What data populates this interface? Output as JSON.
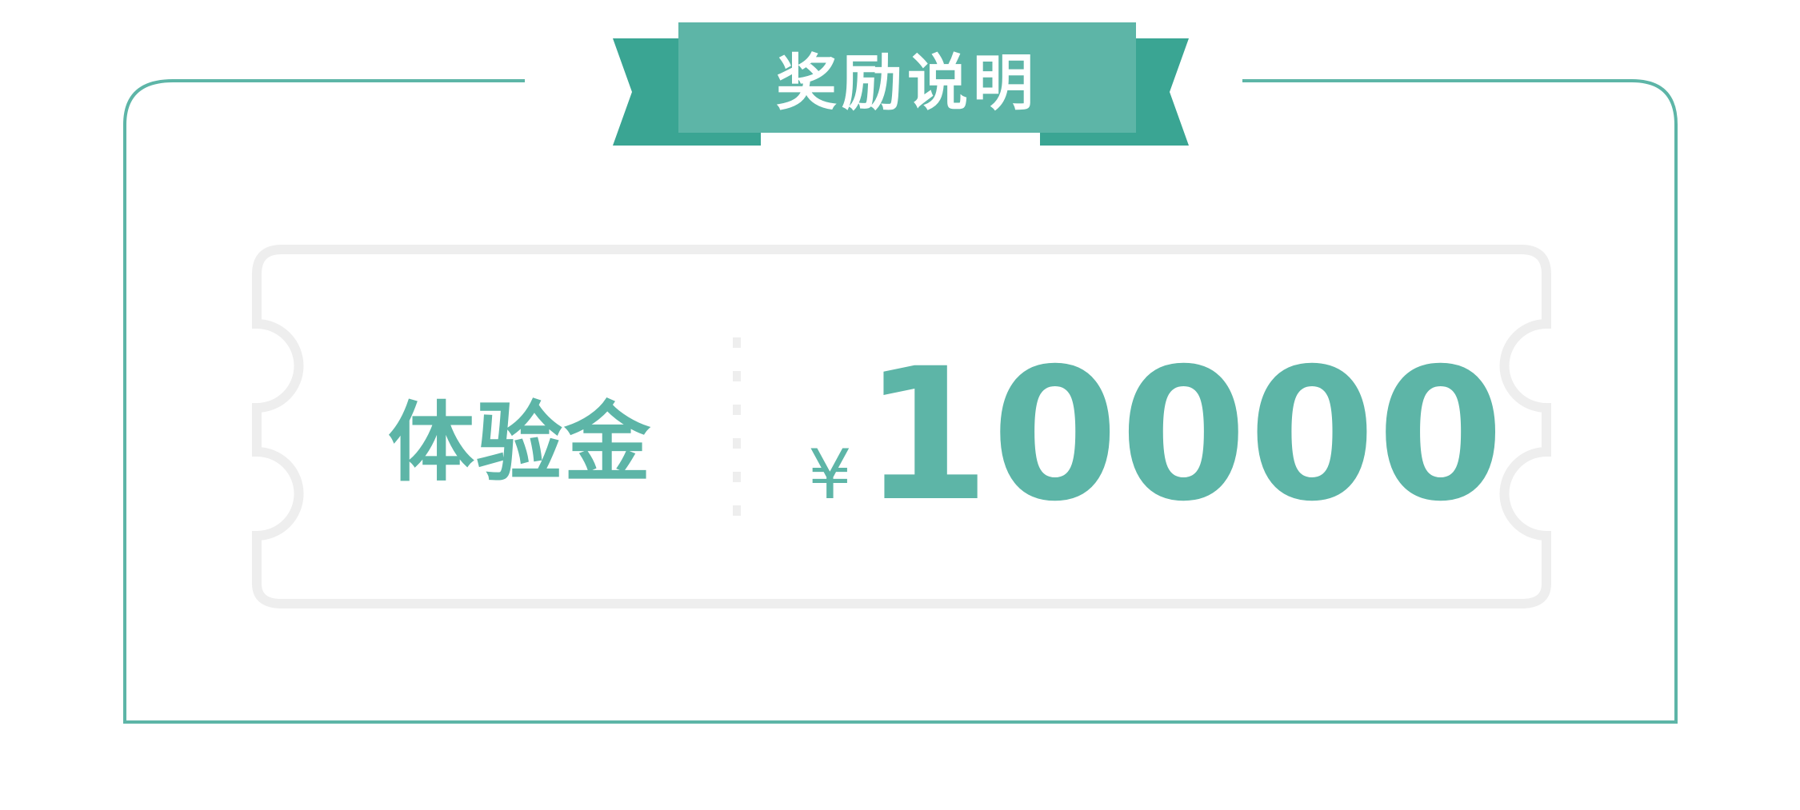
{
  "banner": {
    "title": "奖励说明"
  },
  "coupon": {
    "label": "体验金",
    "currency_symbol": "¥",
    "amount": "10000"
  },
  "colors": {
    "accent": "#5db5a7",
    "accent_dark": "#3aa593",
    "coupon_border": "#eeeeee"
  }
}
